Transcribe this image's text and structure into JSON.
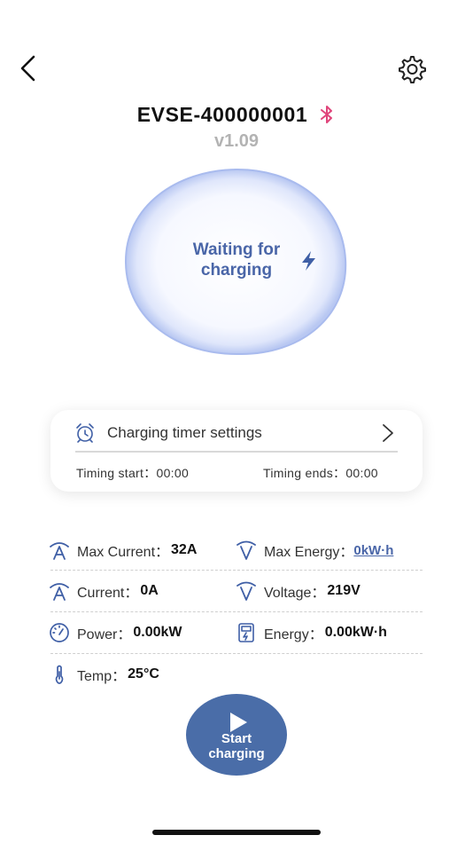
{
  "header": {
    "device_name": "EVSE-400000001",
    "version": "v1.09",
    "back_icon": "chevron-left-icon",
    "settings_icon": "gear-icon",
    "bluetooth_icon": "bluetooth-icon",
    "bluetooth_color": "#e0457b"
  },
  "status": {
    "line1": "Waiting for",
    "line2": "charging",
    "icon": "lightning-bolt-icon"
  },
  "timer": {
    "title": "Charging timer settings",
    "start_text": "Timing start：00:00",
    "end_text": "Timing ends：00:00",
    "icon": "alarm-clock-icon"
  },
  "stats": {
    "max_current_label": "Max Current：",
    "max_current_value": "32A",
    "max_energy_label": "Max Energy：",
    "max_energy_value": "0kW·h",
    "current_label": "Current：",
    "current_value": "0A",
    "voltage_label": "Voltage：",
    "voltage_value": "219V",
    "power_label": "Power：",
    "power_value": "0.00kW",
    "energy_label": "Energy：",
    "energy_value": "0.00kW·h",
    "temp_label": "Temp：",
    "temp_value": "25°C"
  },
  "start_button": {
    "line1": "Start",
    "line2": "charging"
  },
  "colors": {
    "accent": "#4a6da8",
    "status_text": "#4a66a8",
    "version_gray": "#b3b3b3"
  }
}
